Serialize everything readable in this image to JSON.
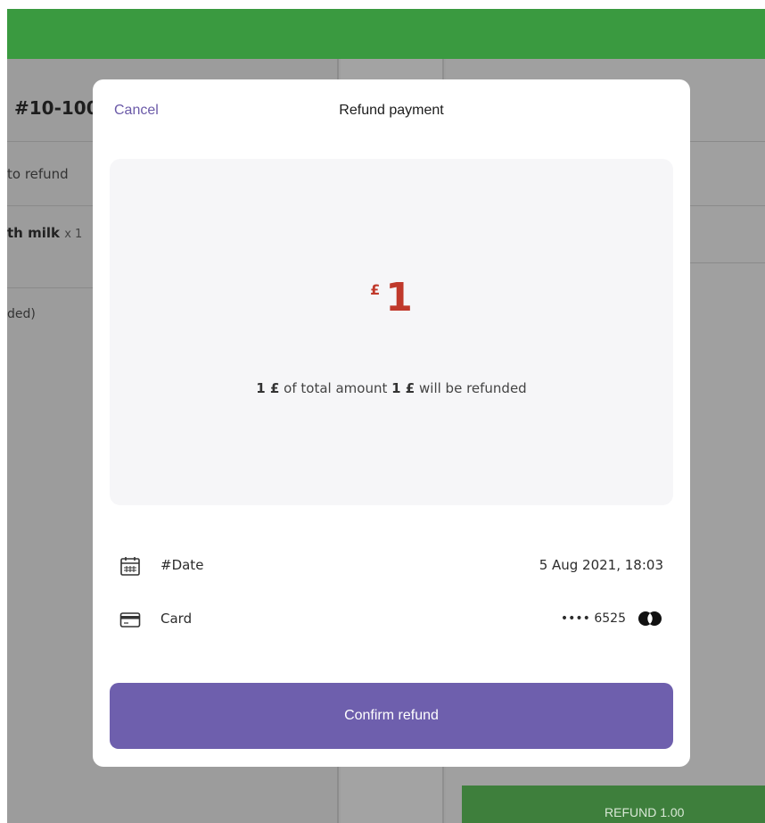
{
  "background": {
    "order_number": "#10-100",
    "to_refund_label": "to refund",
    "item_name": "th milk",
    "item_qty": "x 1",
    "status_text": "ded)",
    "refund_button_label": "REFUND 1.00"
  },
  "modal": {
    "cancel_label": "Cancel",
    "title": "Refund payment",
    "amount": {
      "currency_symbol": "£",
      "value": "1",
      "desc_prefix_amount": "1 £",
      "desc_middle": "of total amount",
      "desc_total_amount": "1 £",
      "desc_suffix": "will be refunded"
    },
    "date_row": {
      "icon": "calendar-icon",
      "label": "#Date",
      "value": "5 Aug 2021, 18:03"
    },
    "card_row": {
      "icon": "credit-card-icon",
      "label": "Card",
      "masked": "•••• 6525",
      "brand_icon": "mastercard-icon"
    },
    "confirm_label": "Confirm refund"
  },
  "colors": {
    "header_green": "#3a9a40",
    "accent_purple": "#6e5fad",
    "amount_red": "#c0392b"
  }
}
